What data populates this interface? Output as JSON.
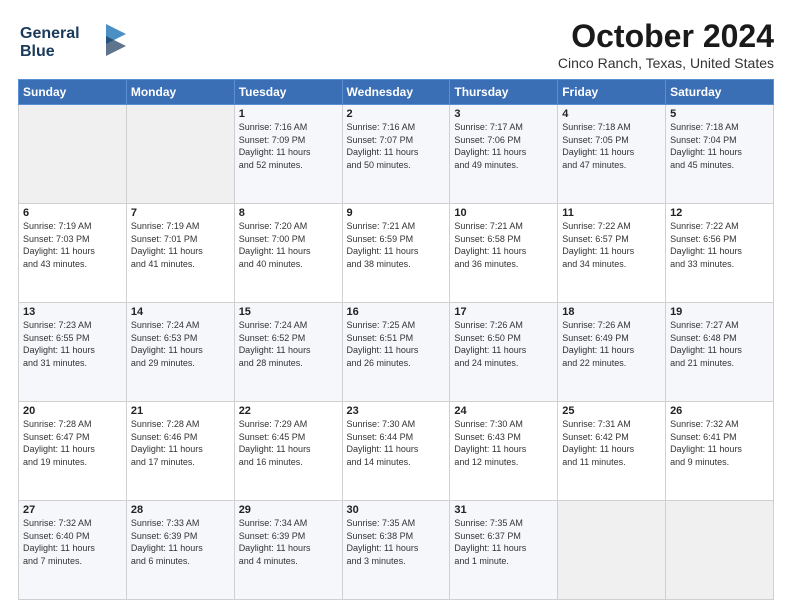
{
  "logo": {
    "line1": "General",
    "line2": "Blue"
  },
  "header": {
    "title": "October 2024",
    "location": "Cinco Ranch, Texas, United States"
  },
  "weekdays": [
    "Sunday",
    "Monday",
    "Tuesday",
    "Wednesday",
    "Thursday",
    "Friday",
    "Saturday"
  ],
  "weeks": [
    [
      {
        "day": "",
        "info": ""
      },
      {
        "day": "",
        "info": ""
      },
      {
        "day": "1",
        "info": "Sunrise: 7:16 AM\nSunset: 7:09 PM\nDaylight: 11 hours\nand 52 minutes."
      },
      {
        "day": "2",
        "info": "Sunrise: 7:16 AM\nSunset: 7:07 PM\nDaylight: 11 hours\nand 50 minutes."
      },
      {
        "day": "3",
        "info": "Sunrise: 7:17 AM\nSunset: 7:06 PM\nDaylight: 11 hours\nand 49 minutes."
      },
      {
        "day": "4",
        "info": "Sunrise: 7:18 AM\nSunset: 7:05 PM\nDaylight: 11 hours\nand 47 minutes."
      },
      {
        "day": "5",
        "info": "Sunrise: 7:18 AM\nSunset: 7:04 PM\nDaylight: 11 hours\nand 45 minutes."
      }
    ],
    [
      {
        "day": "6",
        "info": "Sunrise: 7:19 AM\nSunset: 7:03 PM\nDaylight: 11 hours\nand 43 minutes."
      },
      {
        "day": "7",
        "info": "Sunrise: 7:19 AM\nSunset: 7:01 PM\nDaylight: 11 hours\nand 41 minutes."
      },
      {
        "day": "8",
        "info": "Sunrise: 7:20 AM\nSunset: 7:00 PM\nDaylight: 11 hours\nand 40 minutes."
      },
      {
        "day": "9",
        "info": "Sunrise: 7:21 AM\nSunset: 6:59 PM\nDaylight: 11 hours\nand 38 minutes."
      },
      {
        "day": "10",
        "info": "Sunrise: 7:21 AM\nSunset: 6:58 PM\nDaylight: 11 hours\nand 36 minutes."
      },
      {
        "day": "11",
        "info": "Sunrise: 7:22 AM\nSunset: 6:57 PM\nDaylight: 11 hours\nand 34 minutes."
      },
      {
        "day": "12",
        "info": "Sunrise: 7:22 AM\nSunset: 6:56 PM\nDaylight: 11 hours\nand 33 minutes."
      }
    ],
    [
      {
        "day": "13",
        "info": "Sunrise: 7:23 AM\nSunset: 6:55 PM\nDaylight: 11 hours\nand 31 minutes."
      },
      {
        "day": "14",
        "info": "Sunrise: 7:24 AM\nSunset: 6:53 PM\nDaylight: 11 hours\nand 29 minutes."
      },
      {
        "day": "15",
        "info": "Sunrise: 7:24 AM\nSunset: 6:52 PM\nDaylight: 11 hours\nand 28 minutes."
      },
      {
        "day": "16",
        "info": "Sunrise: 7:25 AM\nSunset: 6:51 PM\nDaylight: 11 hours\nand 26 minutes."
      },
      {
        "day": "17",
        "info": "Sunrise: 7:26 AM\nSunset: 6:50 PM\nDaylight: 11 hours\nand 24 minutes."
      },
      {
        "day": "18",
        "info": "Sunrise: 7:26 AM\nSunset: 6:49 PM\nDaylight: 11 hours\nand 22 minutes."
      },
      {
        "day": "19",
        "info": "Sunrise: 7:27 AM\nSunset: 6:48 PM\nDaylight: 11 hours\nand 21 minutes."
      }
    ],
    [
      {
        "day": "20",
        "info": "Sunrise: 7:28 AM\nSunset: 6:47 PM\nDaylight: 11 hours\nand 19 minutes."
      },
      {
        "day": "21",
        "info": "Sunrise: 7:28 AM\nSunset: 6:46 PM\nDaylight: 11 hours\nand 17 minutes."
      },
      {
        "day": "22",
        "info": "Sunrise: 7:29 AM\nSunset: 6:45 PM\nDaylight: 11 hours\nand 16 minutes."
      },
      {
        "day": "23",
        "info": "Sunrise: 7:30 AM\nSunset: 6:44 PM\nDaylight: 11 hours\nand 14 minutes."
      },
      {
        "day": "24",
        "info": "Sunrise: 7:30 AM\nSunset: 6:43 PM\nDaylight: 11 hours\nand 12 minutes."
      },
      {
        "day": "25",
        "info": "Sunrise: 7:31 AM\nSunset: 6:42 PM\nDaylight: 11 hours\nand 11 minutes."
      },
      {
        "day": "26",
        "info": "Sunrise: 7:32 AM\nSunset: 6:41 PM\nDaylight: 11 hours\nand 9 minutes."
      }
    ],
    [
      {
        "day": "27",
        "info": "Sunrise: 7:32 AM\nSunset: 6:40 PM\nDaylight: 11 hours\nand 7 minutes."
      },
      {
        "day": "28",
        "info": "Sunrise: 7:33 AM\nSunset: 6:39 PM\nDaylight: 11 hours\nand 6 minutes."
      },
      {
        "day": "29",
        "info": "Sunrise: 7:34 AM\nSunset: 6:39 PM\nDaylight: 11 hours\nand 4 minutes."
      },
      {
        "day": "30",
        "info": "Sunrise: 7:35 AM\nSunset: 6:38 PM\nDaylight: 11 hours\nand 3 minutes."
      },
      {
        "day": "31",
        "info": "Sunrise: 7:35 AM\nSunset: 6:37 PM\nDaylight: 11 hours\nand 1 minute."
      },
      {
        "day": "",
        "info": ""
      },
      {
        "day": "",
        "info": ""
      }
    ]
  ]
}
